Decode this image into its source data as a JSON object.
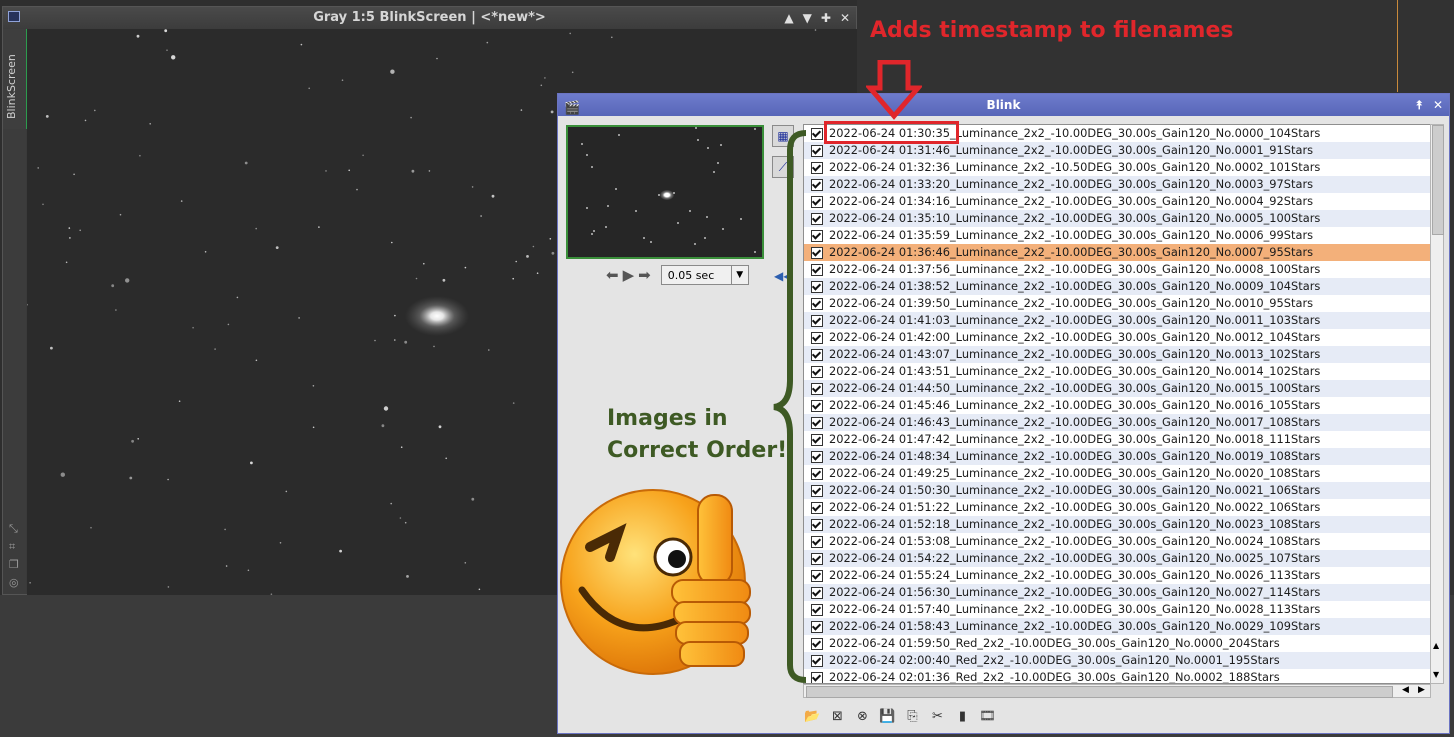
{
  "image_window": {
    "title": "Gray 1:5 BlinkScreen | <*new*>",
    "side_tab": "BlinkScreen",
    "controls": [
      "▲",
      "▼",
      "✚",
      "✕"
    ]
  },
  "blink": {
    "title": "Blink",
    "controls": [
      "⯭",
      "✕"
    ],
    "interval": "0.05 sec",
    "files": [
      "2022-06-24 01:30:35_Luminance_2x2_-10.00DEG_30.00s_Gain120_No.0000_104Stars",
      "2022-06-24 01:31:46_Luminance_2x2_-10.00DEG_30.00s_Gain120_No.0001_91Stars",
      "2022-06-24 01:32:36_Luminance_2x2_-10.50DEG_30.00s_Gain120_No.0002_101Stars",
      "2022-06-24 01:33:20_Luminance_2x2_-10.00DEG_30.00s_Gain120_No.0003_97Stars",
      "2022-06-24 01:34:16_Luminance_2x2_-10.00DEG_30.00s_Gain120_No.0004_92Stars",
      "2022-06-24 01:35:10_Luminance_2x2_-10.00DEG_30.00s_Gain120_No.0005_100Stars",
      "2022-06-24 01:35:59_Luminance_2x2_-10.00DEG_30.00s_Gain120_No.0006_99Stars",
      "2022-06-24 01:36:46_Luminance_2x2_-10.00DEG_30.00s_Gain120_No.0007_95Stars",
      "2022-06-24 01:37:56_Luminance_2x2_-10.00DEG_30.00s_Gain120_No.0008_100Stars",
      "2022-06-24 01:38:52_Luminance_2x2_-10.00DEG_30.00s_Gain120_No.0009_104Stars",
      "2022-06-24 01:39:50_Luminance_2x2_-10.00DEG_30.00s_Gain120_No.0010_95Stars",
      "2022-06-24 01:41:03_Luminance_2x2_-10.00DEG_30.00s_Gain120_No.0011_103Stars",
      "2022-06-24 01:42:00_Luminance_2x2_-10.00DEG_30.00s_Gain120_No.0012_104Stars",
      "2022-06-24 01:43:07_Luminance_2x2_-10.00DEG_30.00s_Gain120_No.0013_102Stars",
      "2022-06-24 01:43:51_Luminance_2x2_-10.00DEG_30.00s_Gain120_No.0014_102Stars",
      "2022-06-24 01:44:50_Luminance_2x2_-10.00DEG_30.00s_Gain120_No.0015_100Stars",
      "2022-06-24 01:45:46_Luminance_2x2_-10.00DEG_30.00s_Gain120_No.0016_105Stars",
      "2022-06-24 01:46:43_Luminance_2x2_-10.00DEG_30.00s_Gain120_No.0017_108Stars",
      "2022-06-24 01:47:42_Luminance_2x2_-10.00DEG_30.00s_Gain120_No.0018_111Stars",
      "2022-06-24 01:48:34_Luminance_2x2_-10.00DEG_30.00s_Gain120_No.0019_108Stars",
      "2022-06-24 01:49:25_Luminance_2x2_-10.00DEG_30.00s_Gain120_No.0020_108Stars",
      "2022-06-24 01:50:30_Luminance_2x2_-10.00DEG_30.00s_Gain120_No.0021_106Stars",
      "2022-06-24 01:51:22_Luminance_2x2_-10.00DEG_30.00s_Gain120_No.0022_106Stars",
      "2022-06-24 01:52:18_Luminance_2x2_-10.00DEG_30.00s_Gain120_No.0023_108Stars",
      "2022-06-24 01:53:08_Luminance_2x2_-10.00DEG_30.00s_Gain120_No.0024_108Stars",
      "2022-06-24 01:54:22_Luminance_2x2_-10.00DEG_30.00s_Gain120_No.0025_107Stars",
      "2022-06-24 01:55:24_Luminance_2x2_-10.00DEG_30.00s_Gain120_No.0026_113Stars",
      "2022-06-24 01:56:30_Luminance_2x2_-10.00DEG_30.00s_Gain120_No.0027_114Stars",
      "2022-06-24 01:57:40_Luminance_2x2_-10.00DEG_30.00s_Gain120_No.0028_113Stars",
      "2022-06-24 01:58:43_Luminance_2x2_-10.00DEG_30.00s_Gain120_No.0029_109Stars",
      "2022-06-24 01:59:50_Red_2x2_-10.00DEG_30.00s_Gain120_No.0000_204Stars",
      "2022-06-24 02:00:40_Red_2x2_-10.00DEG_30.00s_Gain120_No.0001_195Stars",
      "2022-06-24 02:01:36_Red_2x2_-10.00DEG_30.00s_Gain120_No.0002_188Stars"
    ],
    "selected_index": 7,
    "toolbar_icons": [
      "open-folder-icon",
      "close-selected-icon",
      "close-all-icon",
      "save-icon",
      "copy-files-icon",
      "crop-icon",
      "statistics-icon",
      "video-icon"
    ]
  },
  "annotations": {
    "top": "Adds timestamp to filenames",
    "left_line1": "Images in",
    "left_line2": "Correct Order!"
  },
  "colors": {
    "annotation_red": "#e0262b",
    "annotation_green": "#3e5a24",
    "selected_row": "#f3b07a",
    "title_blue": "#5f6ec2"
  }
}
